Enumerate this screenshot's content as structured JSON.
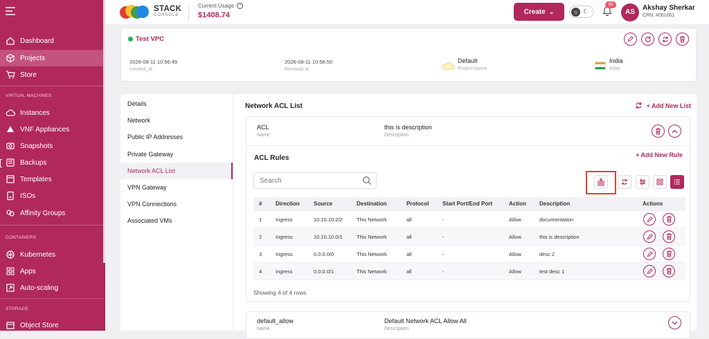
{
  "sidebar": {
    "items": [
      {
        "label": "Dashboard",
        "icon": "home-icon"
      },
      {
        "label": "Projects",
        "icon": "cube-icon"
      },
      {
        "label": "Store",
        "icon": "cart-icon"
      },
      {
        "label": "Instances",
        "icon": "cloud-icon"
      },
      {
        "label": "VNF Appliances",
        "icon": "network-icon"
      },
      {
        "label": "Snapshots",
        "icon": "camera-icon"
      },
      {
        "label": "Backups",
        "icon": "backup-icon"
      },
      {
        "label": "Templates",
        "icon": "template-icon"
      },
      {
        "label": "ISOs",
        "icon": "disc-icon"
      },
      {
        "label": "Affinity Groups",
        "icon": "group-icon"
      },
      {
        "label": "Kubernetes",
        "icon": "kubernetes-icon"
      },
      {
        "label": "Apps",
        "icon": "apps-icon"
      },
      {
        "label": "Auto-scaling",
        "icon": "scaling-icon"
      },
      {
        "label": "Object Store",
        "icon": "storage-icon"
      }
    ],
    "sections": {
      "virtual_machines": "VIRTUAL MACHINES",
      "containers": "CONTAINERS",
      "storage": "STORAGE"
    }
  },
  "header": {
    "logo": {
      "line1": "STACK",
      "line2": "CONSOLE"
    },
    "usage_label": "Current Usage",
    "usage_amount": "$1408.74",
    "create_label": "Create",
    "notification_count": "90",
    "avatar_initials": "AS",
    "user_name": "Akshay Sherkar",
    "user_crn": "CRN: #001001"
  },
  "vpc": {
    "name": "Test VPC",
    "created_value": "2026-08-11 10:56:49",
    "created_label": "created_at",
    "renewal_value": "2026-08-11 10:56:50",
    "renewal_label": "Renewal at",
    "project_value": "Default",
    "project_label": "Project Name",
    "region_value": "India",
    "region_label": "India"
  },
  "tabs": [
    "Details",
    "Network",
    "Public IP Addresses",
    "Private Gateway",
    "Network ACL List",
    "VPN Gateway",
    "VPN Connections",
    "Associated VMs"
  ],
  "content": {
    "title": "Network ACL List",
    "add_new_list": "+ Add New List",
    "acl": {
      "name": "ACL",
      "name_label": "Name",
      "description": "this is description",
      "description_label": "Description"
    },
    "rules_title": "ACL Rules",
    "add_rule": "+ Add New Rule",
    "search_placeholder": "Search",
    "columns": [
      "#",
      "Direction",
      "Source",
      "Destination",
      "Protocol",
      "Start Port/End Port",
      "Action",
      "Description",
      "Actions"
    ],
    "rows": [
      [
        "1",
        "Ingress",
        "10.10.10.2/2",
        "This Network",
        "all",
        "-",
        "Allow",
        "documentation"
      ],
      [
        "2",
        "Ingress",
        "10.10.10.0/1",
        "This Network",
        "all",
        "-",
        "Allow",
        "this is description"
      ],
      [
        "3",
        "Ingress",
        "0.0.0.0/0",
        "This Network",
        "all",
        "-",
        "Allow",
        "desc 2"
      ],
      [
        "4",
        "Ingress",
        "0.0.0.0/1",
        "This Network",
        "all",
        "-",
        "Allow",
        "test desc 1"
      ]
    ],
    "showing": "Showing 4 of 4 rows",
    "acl2": {
      "name": "default_allow",
      "name_label": "Name",
      "description": "Default Network ACL Allow All",
      "description_label": "Description"
    }
  },
  "colors": {
    "brand": "#b1285c",
    "highlight": "#e0412e",
    "online": "#27ae60"
  }
}
